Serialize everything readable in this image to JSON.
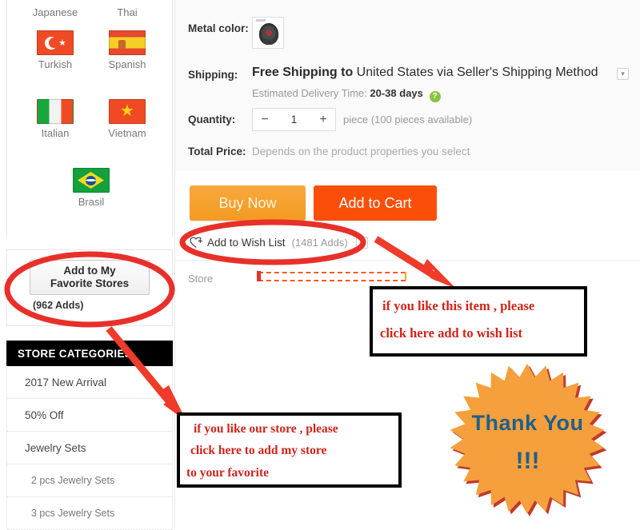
{
  "languages": {
    "top_labels": [
      "Japanese",
      "Thai"
    ],
    "items": [
      {
        "label": "Turkish",
        "flag": "turkey-flag"
      },
      {
        "label": "Spanish",
        "flag": "spain-flag"
      },
      {
        "label": "Italian",
        "flag": "italy-flag"
      },
      {
        "label": "Vietnam",
        "flag": "vietnam-flag"
      },
      {
        "label": "Brasil",
        "flag": "brazil-flag"
      }
    ]
  },
  "favorite_store": {
    "button_line1": "Add to My",
    "button_line2": "Favorite Stores",
    "adds": "(962 Adds)"
  },
  "store_categories": {
    "heading": "STORE CATEGORIES",
    "items": [
      {
        "label": "2017 New Arrival",
        "sub": false
      },
      {
        "label": "50% Off",
        "sub": false
      },
      {
        "label": "Jewelry Sets",
        "sub": false
      },
      {
        "label": "2 pcs Jewelry Sets",
        "sub": true
      },
      {
        "label": "3 pcs Jewelry Sets",
        "sub": true
      }
    ]
  },
  "product": {
    "metal_color_label": "Metal color:",
    "metal_swatch_name": "pendant-thumbnail",
    "shipping_label": "Shipping:",
    "shipping_free": "Free Shipping to",
    "shipping_rest": "United States via Seller's Shipping Method",
    "eta_label": "Estimated Delivery Time:",
    "eta_value": "20-38",
    "eta_unit": "days",
    "eta_help": "?",
    "quantity_label": "Quantity:",
    "quantity_value": "1",
    "quantity_minus": "−",
    "quantity_plus": "+",
    "quantity_note": "piece (100 pieces available)",
    "total_price_label": "Total Price:",
    "total_price_value": "Depends on the product properties you select",
    "store_label": "Store"
  },
  "actions": {
    "buy_now": "Buy Now",
    "add_to_cart": "Add to Cart",
    "wish_list": "Add to Wish List",
    "wish_count": "(1481 Adds)",
    "caret": "▾"
  },
  "annotations": {
    "wish": {
      "line1": "if you like this item , please",
      "line2": "click here add to wish list"
    },
    "store": {
      "line1": "if you like our store , please",
      "line2": "click here to add my store",
      "line3": "to your favorite"
    },
    "thank_you": "Thank You",
    "thank_you_bangs": "!!!"
  },
  "colors": {
    "buy_now": "#f39a22",
    "add_to_cart": "#fb4f09",
    "annotation_red": "#d0241b",
    "marker_red": "#e8302a",
    "starburst_fill": "#f5a03c",
    "starburst_edge": "#c0392b",
    "thank_you_text": "#1f5f8b",
    "category_header": "#000000"
  }
}
